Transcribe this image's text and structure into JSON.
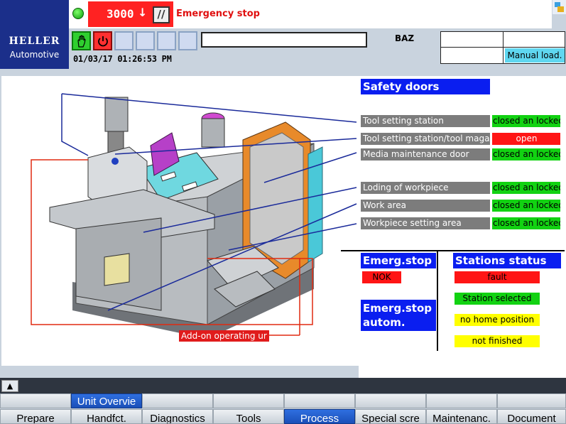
{
  "header": {
    "brand": "HELLER",
    "brand_sub": "Automotive",
    "spindle_speed": "3000",
    "speed_arrow": "↓",
    "slash_symbol": "//",
    "emergency_message": "Emergency stop",
    "channel": "BAZ",
    "datetime": "01/03/17 01:26:53 PM",
    "mode_label": "Manual load."
  },
  "safety_doors": {
    "title": "Safety doors",
    "rows": [
      {
        "label": "Tool setting station",
        "status": "closed an locked",
        "state": "closed"
      },
      {
        "label": "Tool setting station/tool magazine",
        "status": "open",
        "state": "open"
      },
      {
        "label": "Media maintenance door",
        "status": "closed an locked",
        "state": "closed"
      },
      {
        "label": "Loding of workpiece",
        "status": "closed an locked",
        "state": "closed"
      },
      {
        "label": "Work area",
        "status": "closed an locked",
        "state": "closed"
      },
      {
        "label": "Workpiece setting area",
        "status": "closed an locked",
        "state": "closed"
      }
    ]
  },
  "emerg_stop": {
    "title": "Emerg.stop",
    "status": "NOK",
    "autom_title_line1": "Emerg.stop",
    "autom_title_line2": "autom."
  },
  "stations_status": {
    "title": "Stations status",
    "items": [
      "fault",
      "Station selected",
      "no home position",
      "not finished"
    ]
  },
  "image_callout": "Add-on operating ur",
  "softkeys": {
    "top": [
      "",
      "Unit Overvie",
      "",
      "",
      "",
      "",
      "",
      ""
    ],
    "bottom": [
      "Prepare",
      "Handfct.",
      "Diagnostics",
      "Tools",
      "Process",
      "Special scre",
      "Maintenanc.",
      "Document"
    ]
  },
  "colors": {
    "header_blue": "#1b2f8a",
    "title_blue": "#0a1ef0",
    "status_green": "#12d212",
    "status_red": "#ff1515",
    "status_yellow": "#ffff00",
    "mode_cyan": "#5fd7f0"
  }
}
